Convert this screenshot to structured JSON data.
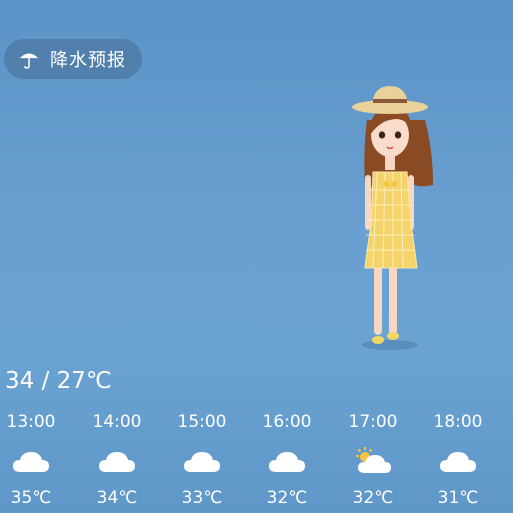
{
  "precip_button": {
    "label": "降水预报",
    "icon": "umbrella-icon"
  },
  "temp_range": "34 / 27℃",
  "hourly": [
    {
      "time": "13:00",
      "icon": "cloud-icon",
      "temp": "35℃"
    },
    {
      "time": "14:00",
      "icon": "cloud-icon",
      "temp": "34℃"
    },
    {
      "time": "15:00",
      "icon": "cloud-icon",
      "temp": "33℃"
    },
    {
      "time": "16:00",
      "icon": "cloud-icon",
      "temp": "32℃"
    },
    {
      "time": "17:00",
      "icon": "sun-cloud-icon",
      "temp": "32℃"
    },
    {
      "time": "18:00",
      "icon": "cloud-icon",
      "temp": "31℃"
    }
  ],
  "colors": {
    "background": "#6aa0d1",
    "sun": "#f6c544",
    "dress": "#f4d36a"
  }
}
